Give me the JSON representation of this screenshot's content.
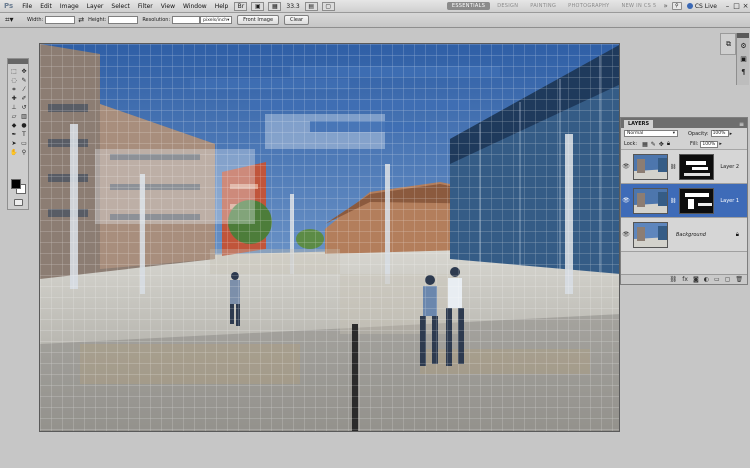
{
  "menubar": {
    "logo": "Ps",
    "items": [
      "File",
      "Edit",
      "Image",
      "Layer",
      "Select",
      "Filter",
      "View",
      "Window",
      "Help"
    ],
    "zoom": "33.3",
    "workspaces": [
      "ESSENTIALS",
      "DESIGN",
      "PAINTING",
      "PHOTOGRAPHY",
      "NEW IN CS 5"
    ],
    "more": "»",
    "cs_live": "CS Live",
    "window_controls": [
      "–",
      "□",
      "×"
    ],
    "tool_icons": [
      "bridge-icon",
      "mini-bridge-icon",
      "view-extras-icon",
      "zoom-level-icon",
      "arrange-documents-icon",
      "screen-mode-icon"
    ]
  },
  "options": {
    "width_label": "Width:",
    "width_value": "",
    "height_label": "Height:",
    "height_value": "",
    "resolution_label": "Resolution:",
    "resolution_value": "",
    "unit": "pixels/inch",
    "front_image": "Front Image",
    "clear": "Clear"
  },
  "tools": [
    "move-icon",
    "marquee-icon",
    "lasso-icon",
    "quick-selection-icon",
    "crop-icon",
    "eyedropper-icon",
    "healing-icon",
    "brush-icon",
    "clone-stamp-icon",
    "history-brush-icon",
    "eraser-icon",
    "gradient-icon",
    "blur-icon",
    "dodge-icon",
    "pen-icon",
    "type-icon",
    "path-selection-icon",
    "shape-icon",
    "hand-icon",
    "zoom-icon"
  ],
  "colors": {
    "foreground": "#000000",
    "background": "#ffffff",
    "selected_layer": "#3e6bb8"
  },
  "layers_panel": {
    "tab": "LAYERS",
    "blend_mode": "Normal",
    "opacity_label": "Opacity:",
    "opacity_value": "100%",
    "lock_label": "Lock:",
    "fill_label": "Fill:",
    "fill_value": "100%",
    "layers": [
      {
        "name": "Layer 2",
        "selected": false,
        "has_mask": true
      },
      {
        "name": "Layer 1",
        "selected": true,
        "has_mask": true
      },
      {
        "name": "Background",
        "selected": false,
        "has_mask": false,
        "locked": true
      }
    ],
    "footer_icons": [
      "link-icon",
      "fx-icon",
      "mask-icon",
      "adjustment-icon",
      "folder-icon",
      "new-layer-icon",
      "trash-icon"
    ]
  }
}
